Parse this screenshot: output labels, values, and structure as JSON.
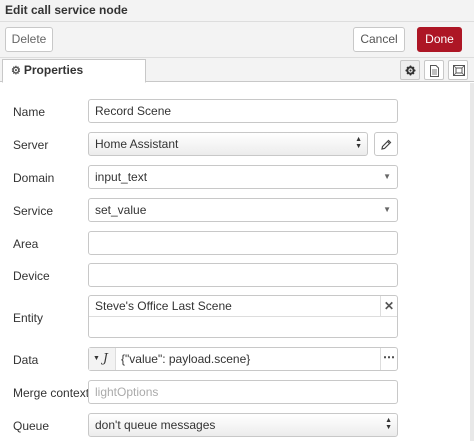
{
  "title": "Edit call service node",
  "toolbar": {
    "delete_label": "Delete",
    "cancel_label": "Cancel",
    "done_label": "Done",
    "done_color": "#ad1625"
  },
  "tabs": {
    "properties_label": "Properties",
    "icons": [
      "gear-icon",
      "description-icon",
      "appearance-icon"
    ]
  },
  "form": {
    "name": {
      "label": "Name",
      "value": "Record Scene"
    },
    "server": {
      "label": "Server",
      "value": "Home Assistant"
    },
    "domain": {
      "label": "Domain",
      "value": "input_text"
    },
    "service": {
      "label": "Service",
      "value": "set_value"
    },
    "area": {
      "label": "Area",
      "value": ""
    },
    "device": {
      "label": "Device",
      "value": ""
    },
    "entity": {
      "label": "Entity",
      "value": "Steve's Office Last Scene"
    },
    "data": {
      "label": "Data",
      "value": "{\"value\": payload.scene}"
    },
    "merge_context": {
      "label": "Merge context",
      "placeholder": "lightOptions"
    },
    "queue": {
      "label": "Queue",
      "value": "don't queue messages"
    }
  }
}
